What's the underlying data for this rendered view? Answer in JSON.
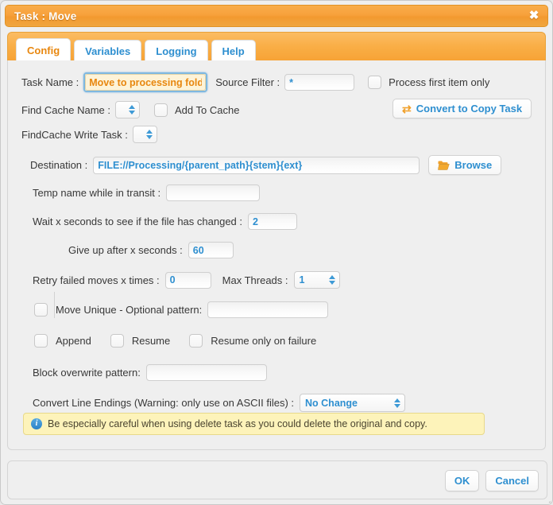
{
  "window": {
    "title": "Task : Move",
    "close_icon": "close-icon",
    "close_glyph": "✖"
  },
  "tabs": [
    {
      "label": "Config",
      "active": true
    },
    {
      "label": "Variables",
      "active": false
    },
    {
      "label": "Logging",
      "active": false
    },
    {
      "label": "Help",
      "active": false
    }
  ],
  "form": {
    "task_name_label": "Task Name :",
    "task_name_value": "Move to processing folder",
    "source_filter_label": "Source Filter :",
    "source_filter_value": "*",
    "process_first_item_label": "Process first item only",
    "process_first_item_checked": false,
    "find_cache_name_label": "Find Cache Name :",
    "find_cache_name_value": "",
    "add_to_cache_label": "Add To Cache",
    "add_to_cache_checked": false,
    "convert_button_label": "Convert to Copy Task",
    "convert_icon": "convert-arrows-icon",
    "convert_glyph": "⇄",
    "findcache_write_task_label": "FindCache Write Task :",
    "findcache_write_task_value": "",
    "destination_label": "Destination :",
    "destination_value": "FILE://Processing/{parent_path}{stem}{ext}",
    "browse_button_label": "Browse",
    "browse_icon": "folder-open-icon",
    "temp_name_label": "Temp name while in transit :",
    "temp_name_value": "",
    "wait_seconds_label": "Wait x seconds to see if the file has changed :",
    "wait_seconds_value": "2",
    "give_up_label": "Give up after x seconds :",
    "give_up_value": "60",
    "retry_label": "Retry failed moves x times :",
    "retry_value": "0",
    "max_threads_label": "Max Threads :",
    "max_threads_value": "1",
    "move_unique_label": "Move Unique - Optional pattern:",
    "move_unique_checked": false,
    "move_unique_pattern": "",
    "append_label": "Append",
    "append_checked": false,
    "resume_label": "Resume",
    "resume_checked": false,
    "resume_failure_label": "Resume only on failure",
    "resume_failure_checked": false,
    "block_overwrite_label": "Block overwrite pattern:",
    "block_overwrite_value": "",
    "convert_line_endings_label": "Convert Line Endings (Warning: only use on ASCII files) :",
    "convert_line_endings_value": "No Change"
  },
  "warning": {
    "icon": "info-icon",
    "glyph": "i",
    "text": "Be especially careful when using delete task as you could delete the original and copy."
  },
  "footer": {
    "ok_label": "OK",
    "cancel_label": "Cancel"
  },
  "colors": {
    "accent_orange": "#f7a336",
    "link_blue": "#2e8fd0",
    "warning_bg": "#fdf3ba",
    "focus_ring": "#7fb8e0"
  }
}
